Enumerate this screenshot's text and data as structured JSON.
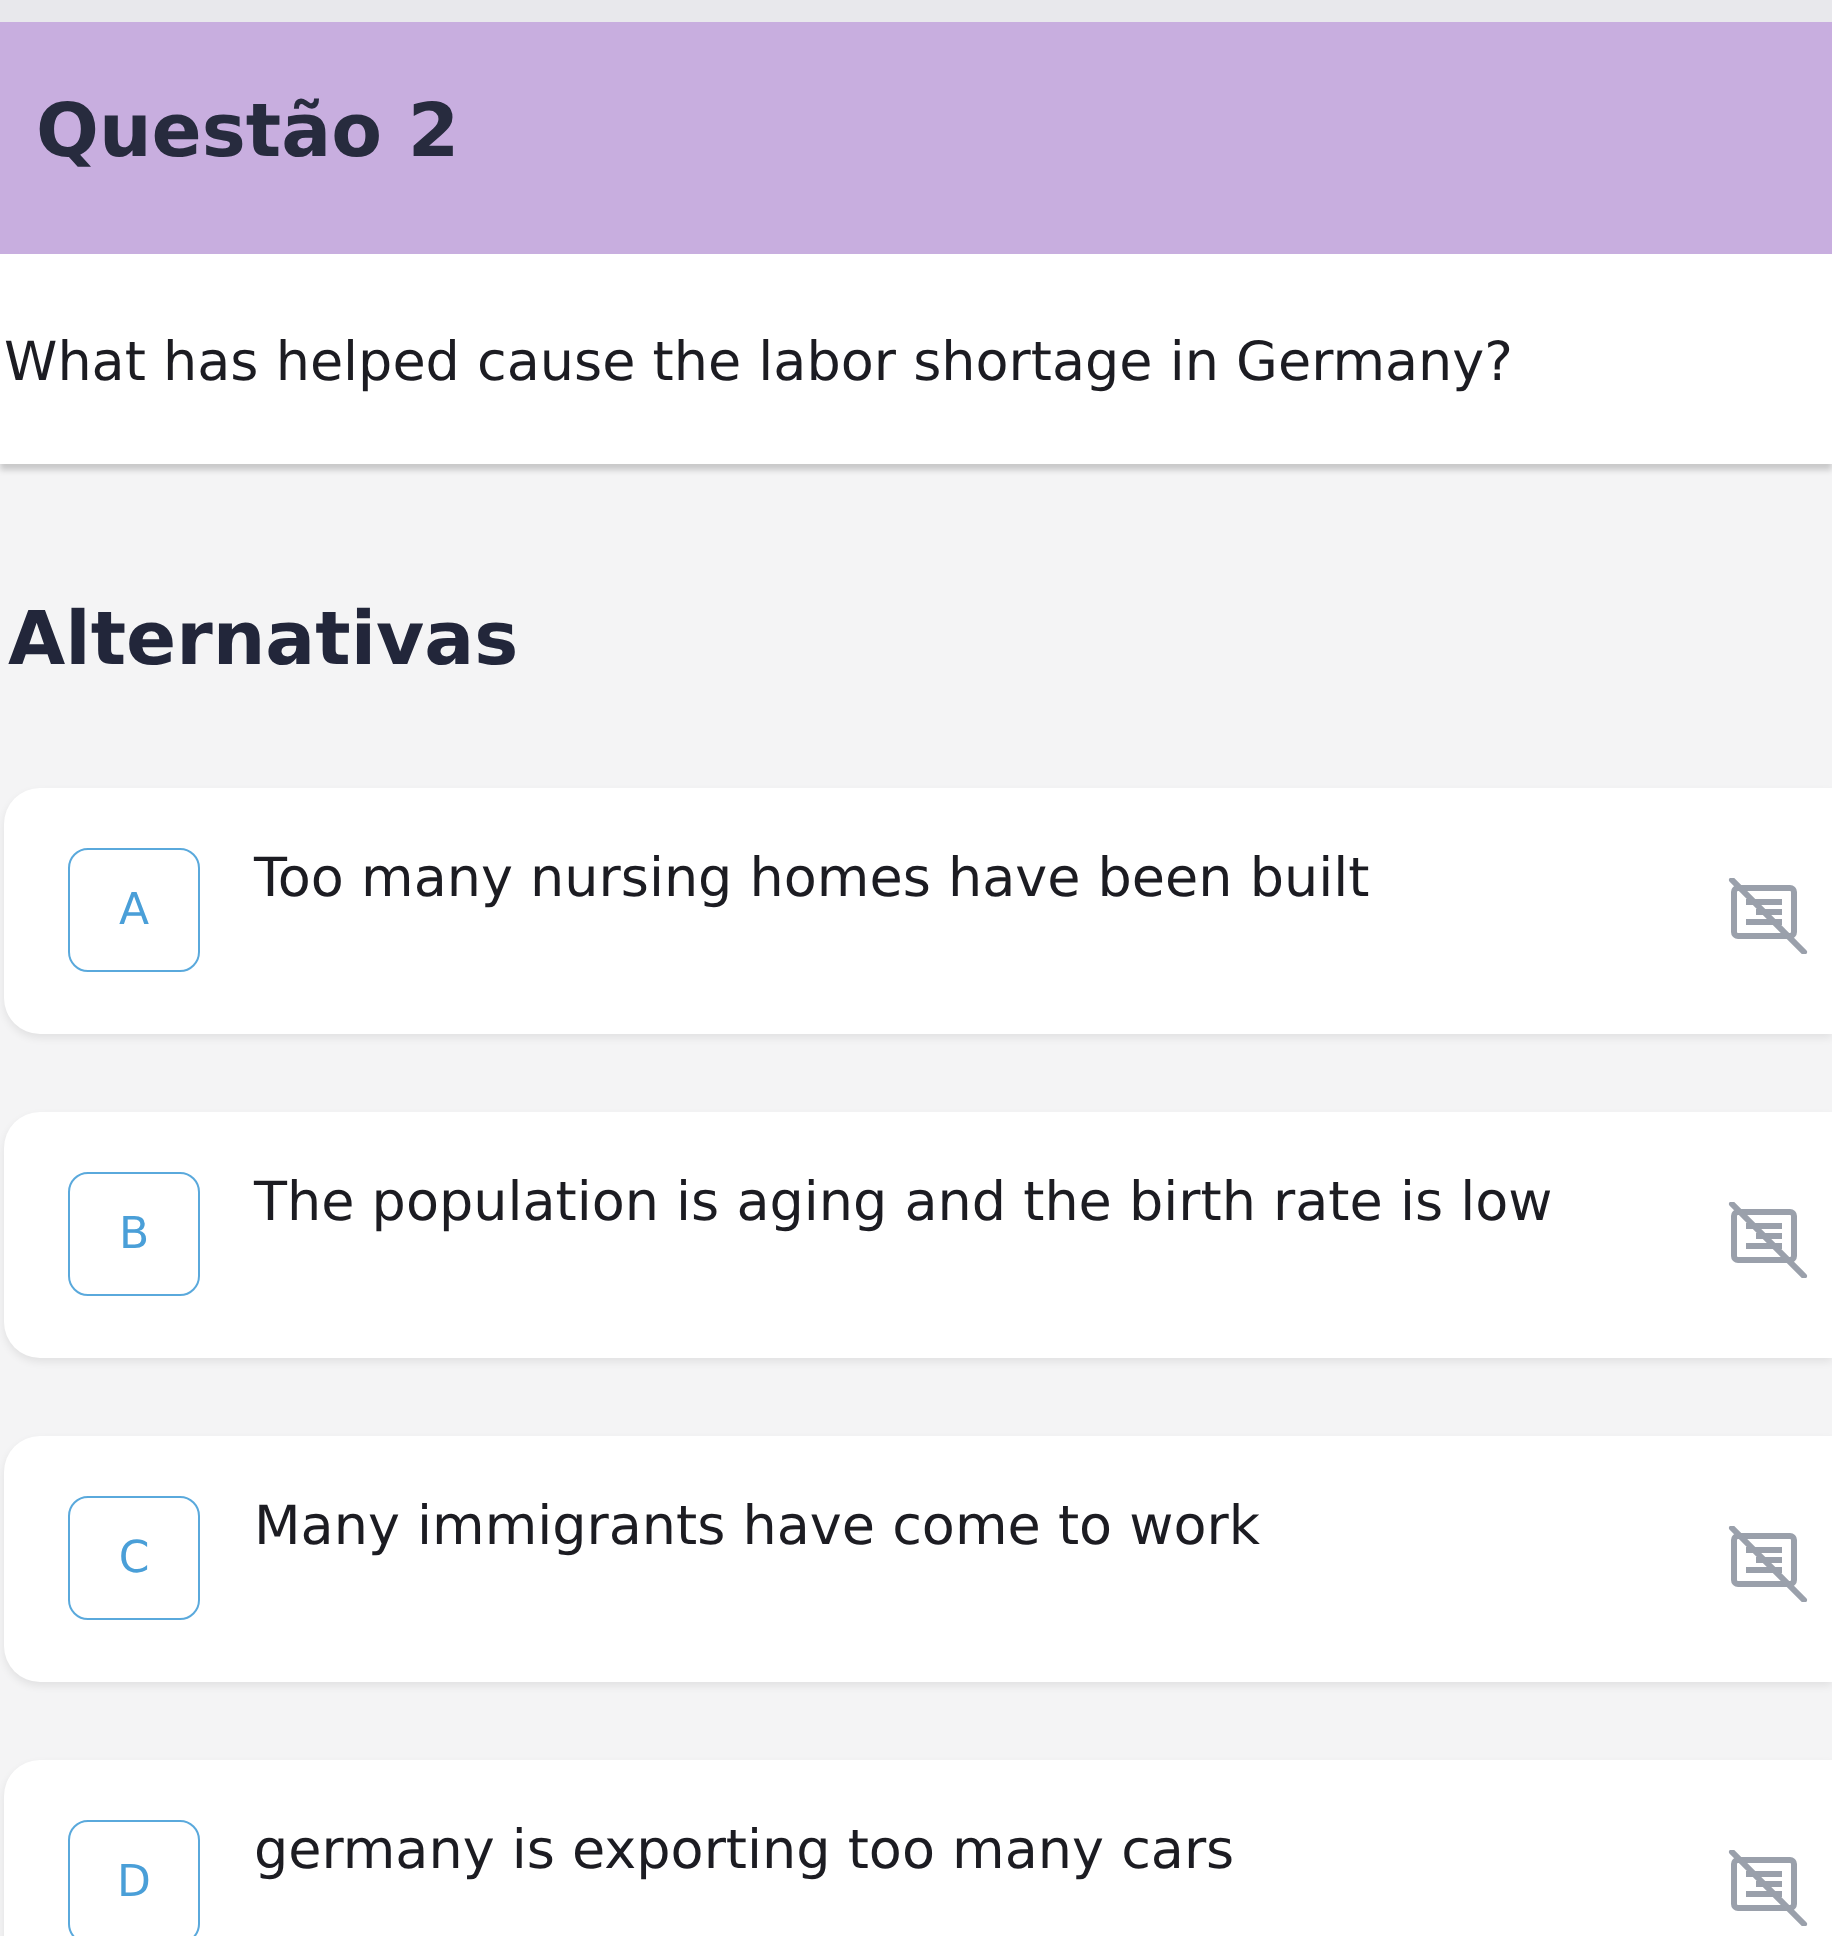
{
  "header": {
    "title": "Questão 2"
  },
  "question": {
    "text": "What has helped cause the labor shortage in Germany?"
  },
  "alternatives": {
    "title": "Alternativas",
    "options": [
      {
        "letter": "A",
        "text": "Too many nursing homes have been built",
        "selected": false
      },
      {
        "letter": "B",
        "text": "The population is aging and the birth rate is low",
        "selected": false
      },
      {
        "letter": "C",
        "text": "Many immigrants have come to work",
        "selected": false
      },
      {
        "letter": "D",
        "text": "germany is exporting too many cars",
        "selected": false
      }
    ]
  }
}
